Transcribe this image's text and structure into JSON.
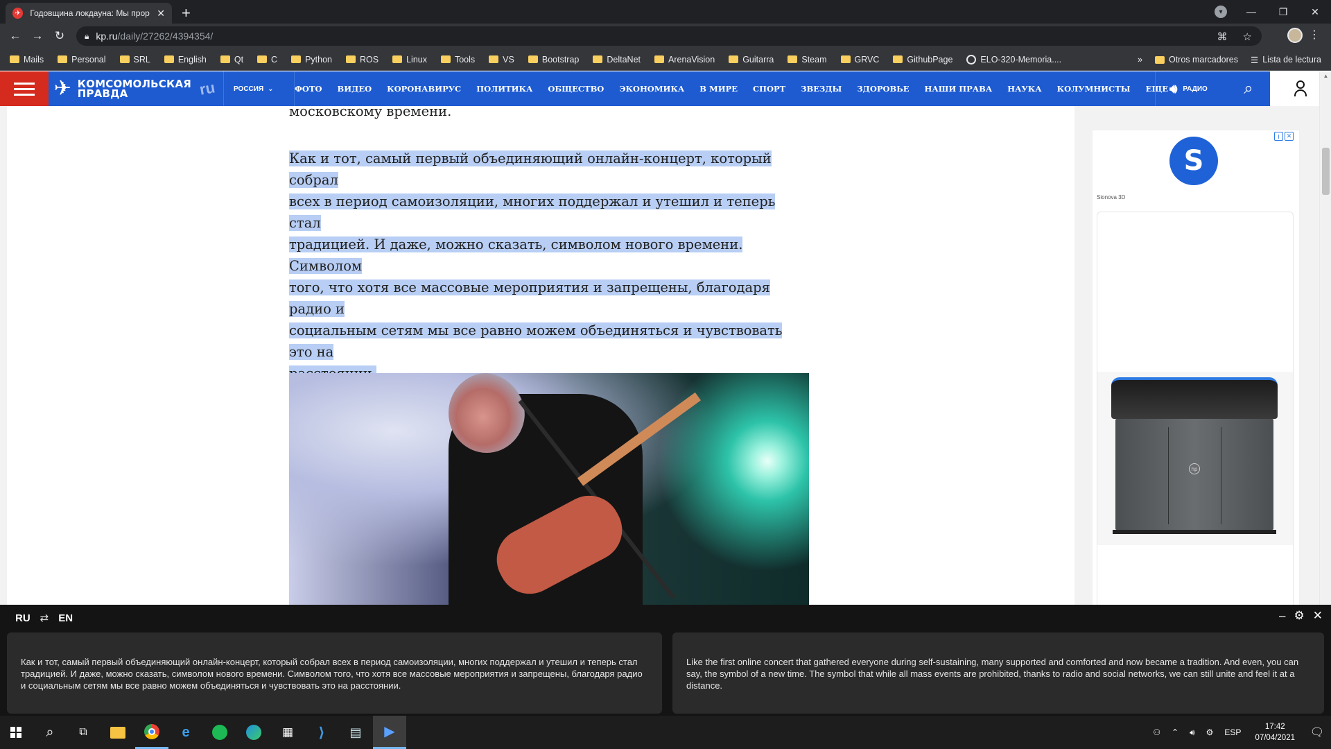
{
  "browser": {
    "tab_title": "Годовщина локдауна: Мы прор",
    "url_host": "kp.ru",
    "url_path": "/daily/27262/4394354/",
    "bookmarks": [
      "Mails",
      "Personal",
      "SRL",
      "English",
      "Qt",
      "C",
      "Python",
      "ROS",
      "Linux",
      "Tools",
      "VS",
      "Bootstrap",
      "DeltaNet",
      "ArenaVision",
      "Guitarra",
      "Steam",
      "GRVC",
      "GithubPage",
      "ELO-320-Memoria...."
    ],
    "bookmarks_more": "»",
    "other_bookmarks": "Otros marcadores",
    "reading_list": "Lista de lectura"
  },
  "site": {
    "logo_line1": "Комсомольская",
    "logo_line2": "правда",
    "logo_ru": "ru",
    "region": "Россия",
    "nav": [
      "Фото",
      "Видео",
      "Коронавирус",
      "Политика",
      "Общество",
      "Экономика",
      "В мире",
      "Спорт",
      "Звезды",
      "Здоровье",
      "Наши права",
      "Наука",
      "Колумнисты",
      "Еще"
    ],
    "radio": "Радио"
  },
  "article": {
    "prev_line": "московскому времени.",
    "highlight_lines": [
      "Как и тот, самый первый объединяющий онлайн-концерт, который собрал",
      "всех в период самоизоляции, многих поддержал и утешил и теперь стал",
      "традицией. И даже, можно сказать, символом нового времени. Символом",
      "того, что хотя все массовые мероприятия и запрещены, благодаря радио и",
      "социальным сетям мы все равно можем объединяться и чувствовать это на",
      "расстоянии."
    ]
  },
  "ad": {
    "logo_letter": "S",
    "brand": "Sionova 3D",
    "printer_logo": "hp"
  },
  "translator": {
    "source_lang": "RU",
    "swap": "⇄",
    "target_lang": "EN",
    "source_text": "Как и тот, самый первый объединяющий онлайн-концерт, который собрал всех в период самоизоляции, многих поддержал и утешил и теперь стал традицией. И даже, можно сказать, символом нового времени. Символом того, что хотя все массовые мероприятия и запрещены, благодаря радио и социальным сетям мы все равно можем объединяться и чувствовать это на расстоянии.",
    "target_text": "Like the first online concert that gathered everyone during self-sustaining, many supported and comforted and now became a tradition. And even, you can say, the symbol of a new time. The symbol that while all mass events are prohibited, thanks to radio and social networks, we can still unite and feel it at a distance."
  },
  "taskbar": {
    "language": "ESP",
    "time": "17:42",
    "date": "07/04/2021"
  },
  "colors": {
    "kp_blue": "#1e5bd1",
    "kp_red": "#d52b1e",
    "highlight": "#b8cef4"
  }
}
